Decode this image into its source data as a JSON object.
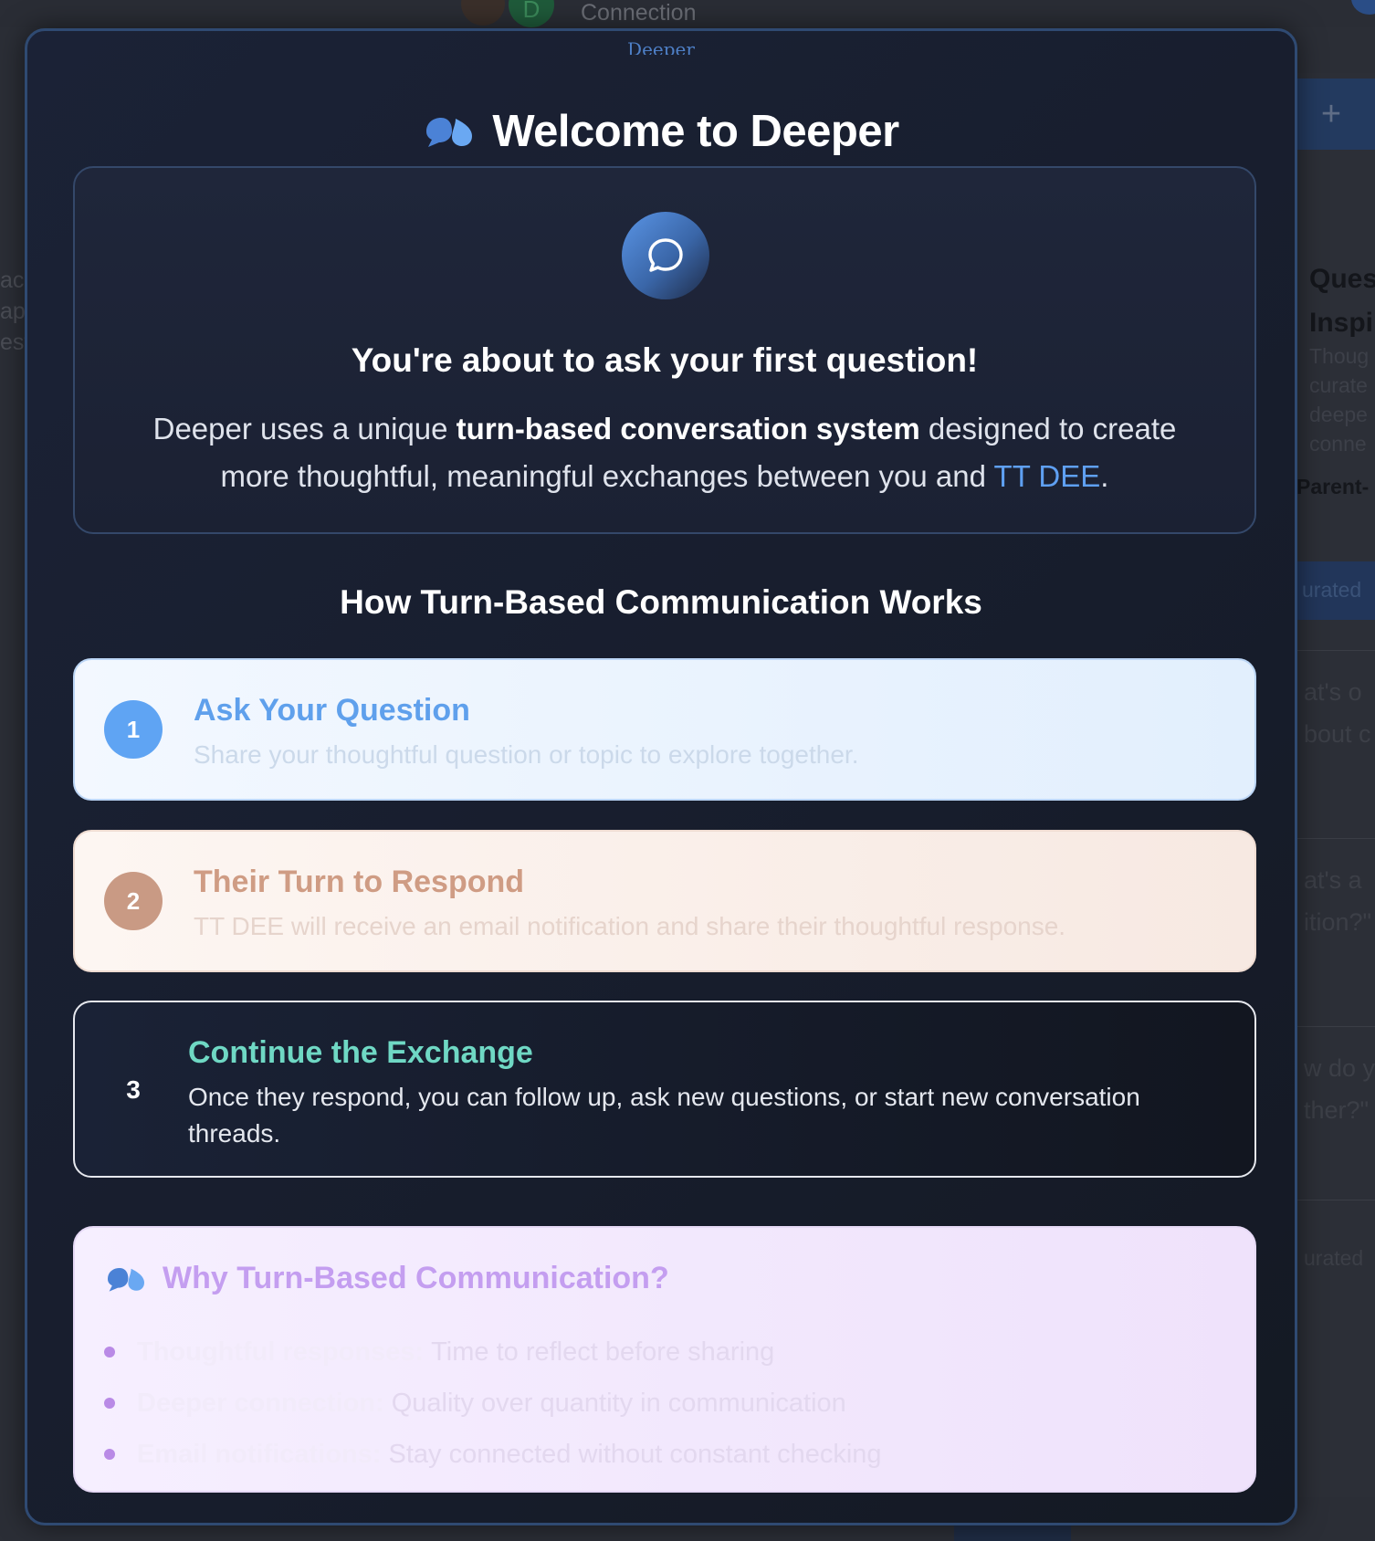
{
  "background": {
    "connection_label": "Connection",
    "avatar_initial": "D",
    "plus_label": "+",
    "question_title_line1": "Ques",
    "question_title_line2": "Inspi",
    "question_desc_lines": [
      "Thoug",
      "curate",
      "deepe",
      "conne"
    ],
    "parent_label": "Parent-",
    "curated_tab": "urated",
    "left_lines": [
      "ac",
      "ap",
      "est"
    ],
    "cards": [
      "at's o",
      "bout c",
      "at's a",
      "ition?\"",
      "w do y",
      "ther?\"",
      "urated"
    ]
  },
  "modal": {
    "brand": "Deeper",
    "title": "Welcome to Deeper",
    "intro": {
      "heading": "You're about to ask your first question!",
      "text_before": "Deeper uses a unique ",
      "text_bold": "turn-based conversation system",
      "text_middle": " designed to create more thoughtful, meaningful exchanges between you and ",
      "partner_name": "TT DEE",
      "text_end": "."
    },
    "how_heading": "How Turn-Based Communication Works",
    "steps": [
      {
        "number": "1",
        "title": "Ask Your Question",
        "description": "Share your thoughtful question or topic to explore together.",
        "color": "#5fa4f3"
      },
      {
        "number": "2",
        "title": "Their Turn to Respond",
        "description": "TT DEE will receive an email notification and share their thoughtful response.",
        "color": "#c99a84"
      },
      {
        "number": "3",
        "title": "Continue the Exchange",
        "description": "Once they respond, you can follow up, ask new questions, or start new conversation threads.",
        "color": "#6fd8c4"
      }
    ],
    "why": {
      "title": "Why Turn-Based Communication?",
      "items": [
        {
          "label": "Thoughtful responses:",
          "text": "Time to reflect before sharing"
        },
        {
          "label": "Deeper connection:",
          "text": "Quality over quantity in communication"
        },
        {
          "label": "Email notifications:",
          "text": "Stay connected without constant checking"
        }
      ]
    }
  },
  "icons": {
    "logo": "quote-bubbles-icon",
    "chat": "chat-bubble-icon"
  },
  "colors": {
    "accent_blue": "#5fa0f2",
    "modal_border": "#2f4a72",
    "step3_title": "#6fd8c4",
    "why_title": "#c49ef0"
  }
}
